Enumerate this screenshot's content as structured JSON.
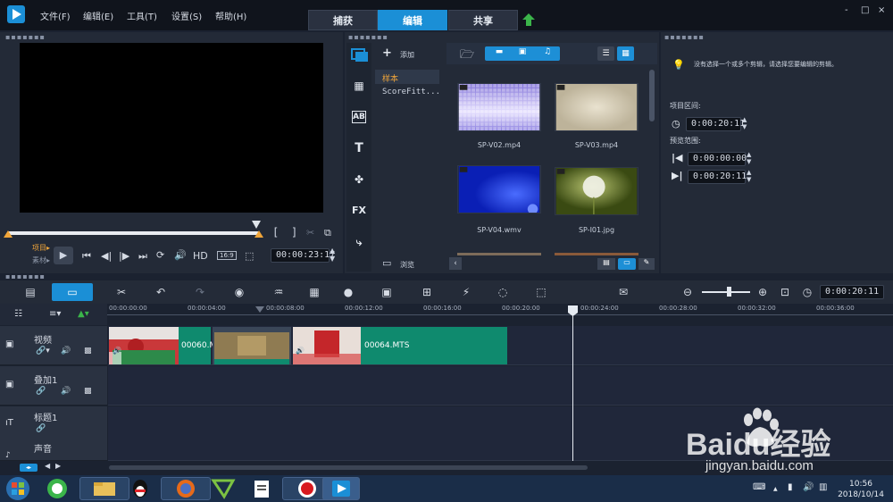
{
  "menu": [
    "文件(F)",
    "编辑(E)",
    "工具(T)",
    "设置(S)",
    "帮助(H)"
  ],
  "tabs": [
    {
      "label": "捕获",
      "active": false
    },
    {
      "label": "编辑",
      "active": true
    },
    {
      "label": "共享",
      "active": false
    }
  ],
  "window_controls": [
    "-",
    "□",
    "×"
  ],
  "player": {
    "project_label": "项目▸",
    "clip_label": "素材▸",
    "hd_label": "HD",
    "ratio_label": "16:9",
    "timecode": "00:00:23:17",
    "mark_in": "[",
    "mark_out": "]"
  },
  "library": {
    "add_label": "添加",
    "browse_label": "浏览",
    "folders": [
      "样本",
      "ScoreFitt..."
    ],
    "thumbnails": [
      {
        "label": "SP-V02.mp4",
        "badge": "video"
      },
      {
        "label": "SP-V03.mp4",
        "badge": "video"
      },
      {
        "label": "SP-V04.wmv",
        "badge": "video"
      },
      {
        "label": "SP-I01.jpg",
        "badge": "image"
      }
    ],
    "side_icons": [
      "media-icon",
      "instant-project-icon",
      "transition-icon",
      "title-icon",
      "graphic-icon",
      "filter-icon",
      "path-icon"
    ],
    "fx_label": "FX",
    "title_label": "T",
    "transition_label": "AB"
  },
  "options": {
    "hint": "没有选择一个或多个剪辑，请选择您要编辑的剪辑。",
    "duration_label": "项目区间:",
    "duration_value": "0:00:20:11",
    "preview_range_label": "预览范围:",
    "range_start": "0:00:00:00",
    "range_end": "0:00:20:11"
  },
  "timeline": {
    "timecode": "0:00:20:11",
    "ruler": [
      "00:00:00:00",
      "00:00:04:00",
      "00:00:08:00",
      "00:00:12:00",
      "00:00:16:00",
      "00:00:20:00",
      "00:00:24:00",
      "00:00:28:00",
      "00:00:32:00",
      "00:00:36:00"
    ],
    "tracks": [
      {
        "name": "视频"
      },
      {
        "name": "叠加1"
      },
      {
        "name": "标题1"
      },
      {
        "name": "声音"
      }
    ],
    "clips": [
      {
        "label": "00060.M"
      },
      {
        "label": ""
      },
      {
        "label": "00064.MTS"
      }
    ]
  },
  "taskbar": {
    "time": "10:56",
    "date": "2018/10/14"
  },
  "watermark": {
    "brand": "Baidu经验",
    "url": "jingyan.baidu.com"
  },
  "colors": {
    "accent": "#1b8fd6",
    "clip_green": "#0f8a6e",
    "background": "#1b2230"
  }
}
